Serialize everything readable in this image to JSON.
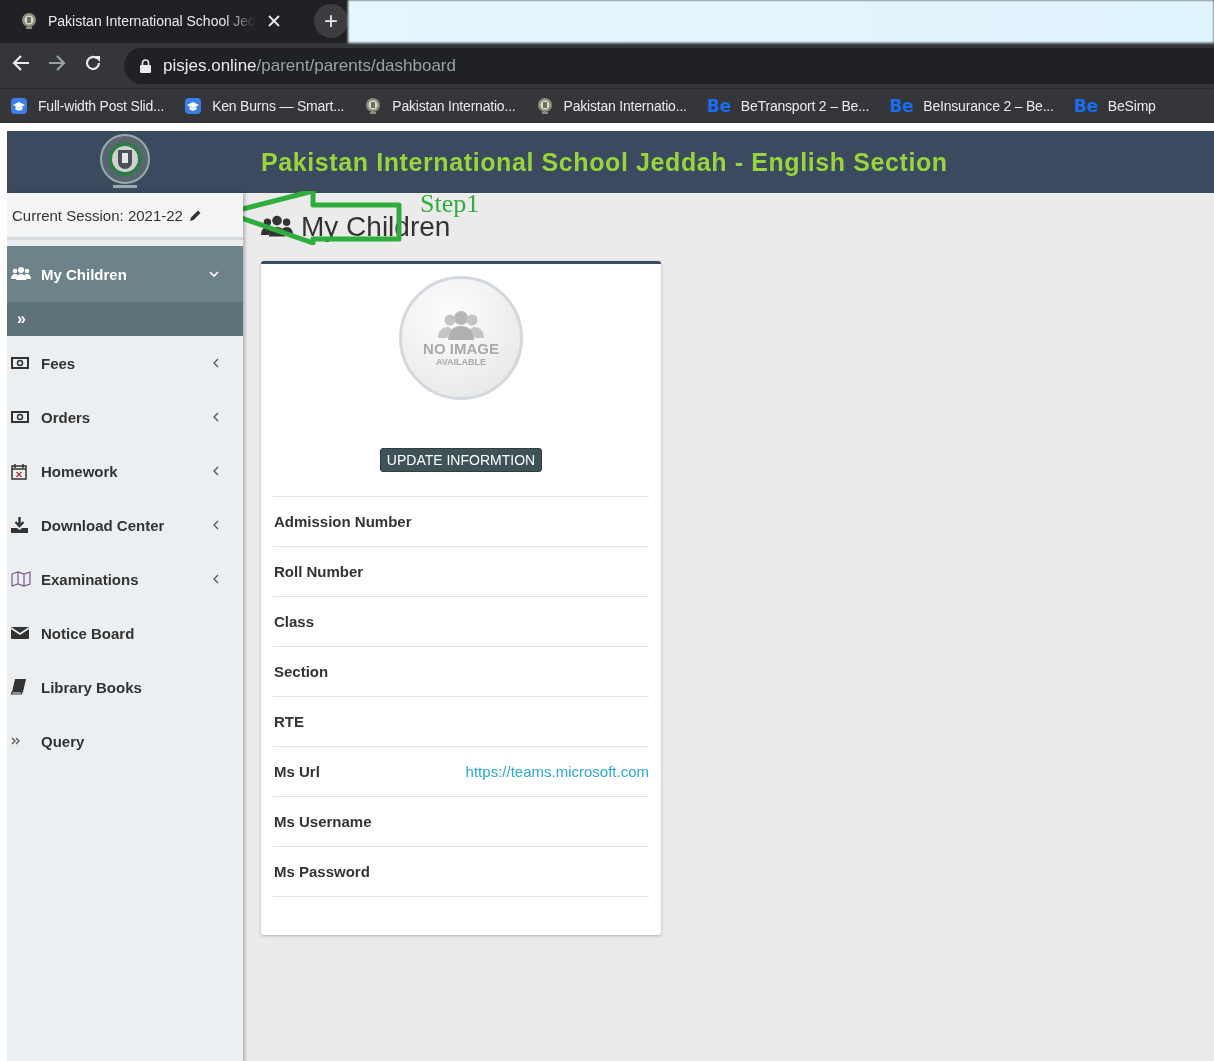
{
  "browser": {
    "active_tab": {
      "title": "Pakistan International School Jed"
    },
    "new_tab_button": "+",
    "url": {
      "host": "pisjes.online",
      "path": "/parent/parents/dashboard"
    },
    "bookmarks": [
      {
        "kind": "cap",
        "label": "Full-width Post Slid..."
      },
      {
        "kind": "cap",
        "label": "Ken Burns — Smart..."
      },
      {
        "kind": "crest",
        "label": "Pakistan Internatio..."
      },
      {
        "kind": "crest",
        "label": "Pakistan Internatio..."
      },
      {
        "kind": "be",
        "badge": "Be",
        "label": "BeTransport 2 – Be..."
      },
      {
        "kind": "be",
        "badge": "Be",
        "label": "BeInsurance 2 – Be..."
      },
      {
        "kind": "be",
        "badge": "Be",
        "label": "BeSimp"
      }
    ]
  },
  "header": {
    "title": "Pakistan International School Jeddah - English Section"
  },
  "session": {
    "label": "Current Session: 2021-22"
  },
  "sidebar": {
    "items": [
      {
        "label": "My Children",
        "selected": true,
        "expandable": true,
        "expanded": true,
        "children": [
          {
            "label": "»"
          }
        ]
      },
      {
        "label": "Fees",
        "selected": false,
        "expandable": true,
        "expanded": false
      },
      {
        "label": "Orders",
        "selected": false,
        "expandable": true,
        "expanded": false
      },
      {
        "label": "Homework",
        "selected": false,
        "expandable": true,
        "expanded": false
      },
      {
        "label": "Download Center",
        "selected": false,
        "expandable": true,
        "expanded": false
      },
      {
        "label": "Examinations",
        "selected": false,
        "expandable": true,
        "expanded": false
      },
      {
        "label": "Notice Board",
        "selected": false,
        "expandable": false
      },
      {
        "label": "Library Books",
        "selected": false,
        "expandable": false
      },
      {
        "label": "Query",
        "selected": false,
        "expandable": false
      }
    ]
  },
  "page": {
    "title": "My Children"
  },
  "annotation": {
    "text": "Step1"
  },
  "card": {
    "no_image": {
      "line1": "NO IMAGE",
      "line2": "AVAILABLE"
    },
    "update_button": "UPDATE INFORMTION",
    "fields": [
      {
        "label": "Admission Number"
      },
      {
        "label": "Roll Number"
      },
      {
        "label": "Class"
      },
      {
        "label": "Section"
      },
      {
        "label": "RTE"
      },
      {
        "label": "Ms Url",
        "value": "https://teams.microsoft.com",
        "kind": "link"
      },
      {
        "label": "Ms Username"
      },
      {
        "label": "Ms Password"
      }
    ]
  }
}
